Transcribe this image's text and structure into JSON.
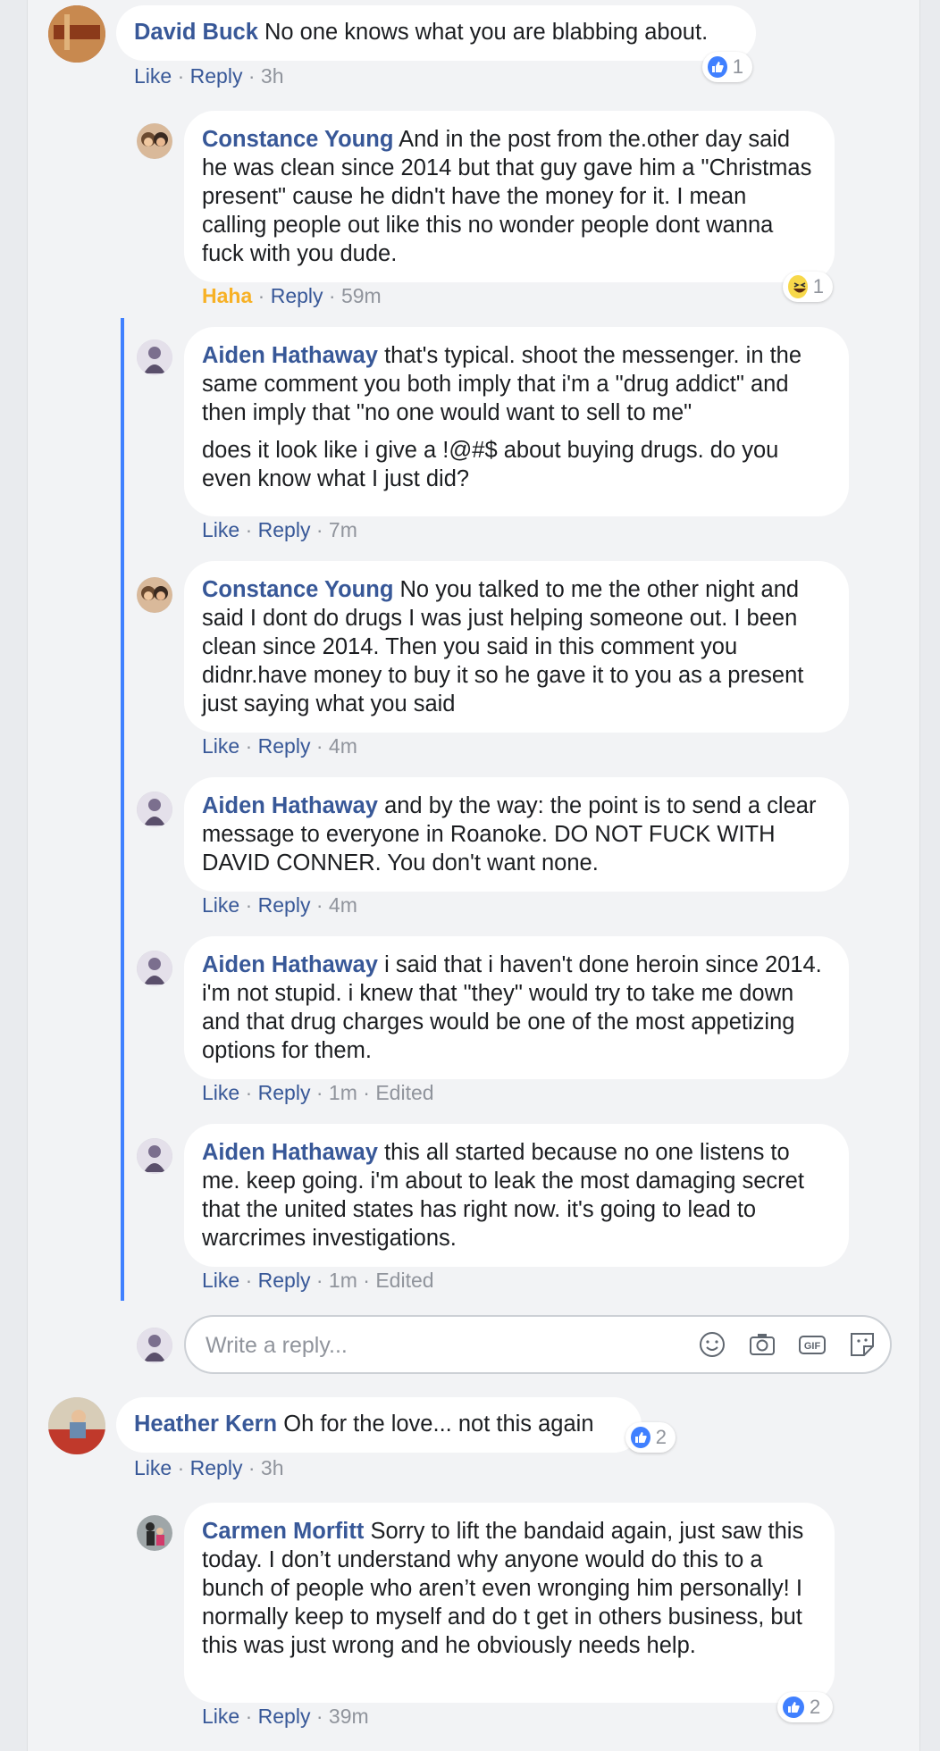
{
  "comments": [
    {
      "name": "David Buck",
      "text": "No one knows what you are blabbing about.",
      "actions": {
        "like": "Like",
        "reply": "Reply",
        "time": "3h"
      },
      "reaction": {
        "type": "like",
        "count": "1"
      }
    },
    {
      "name": "Constance Young",
      "text": "And in the post from the.other day said he was clean since 2014 but that guy gave him a \"Christmas present\" cause he didn't have the money for it. I mean calling people out like this no wonder people dont wanna fuck with you dude.",
      "actions": {
        "like": "Haha",
        "reply": "Reply",
        "time": "59m"
      },
      "reaction": {
        "type": "haha",
        "count": "1"
      }
    },
    {
      "name": "Aiden Hathaway",
      "text": "that's typical. shoot the messenger. in the same comment you both imply that i'm a \"drug addict\" and then imply that \"no one would want to sell to me\"",
      "text2": "does it look like i give a !@#$ about buying drugs. do you even know what I just did?",
      "actions": {
        "like": "Like",
        "reply": "Reply",
        "time": "7m"
      }
    },
    {
      "name": "Constance Young",
      "text": "No you talked to me the other night and said I dont do drugs I was just helping someone out. I been clean since 2014. Then you said in this comment you didnr.have money to buy it so he gave it to you as a present just saying what you said",
      "actions": {
        "like": "Like",
        "reply": "Reply",
        "time": "4m"
      }
    },
    {
      "name": "Aiden Hathaway",
      "text": "and by the way: the point is to send a clear message to everyone in Roanoke. DO NOT FUCK WITH DAVID CONNER. You don't want none.",
      "actions": {
        "like": "Like",
        "reply": "Reply",
        "time": "4m"
      }
    },
    {
      "name": "Aiden Hathaway",
      "text": "i said that i haven't done heroin since 2014. i'm not stupid. i knew that \"they\" would try to take me down and that drug charges would be one of the most appetizing options for them.",
      "actions": {
        "like": "Like",
        "reply": "Reply",
        "time": "1m",
        "edited": "Edited"
      }
    },
    {
      "name": "Aiden Hathaway",
      "text": "this all started because no one listens to me. keep going. i'm about to leak the most damaging secret that the united states has right now. it's going to lead to warcrimes investigations.",
      "actions": {
        "like": "Like",
        "reply": "Reply",
        "time": "1m",
        "edited": "Edited"
      }
    },
    {
      "name": "Heather Kern",
      "text": "Oh for the love... not this again",
      "actions": {
        "like": "Like",
        "reply": "Reply",
        "time": "3h"
      },
      "reaction": {
        "type": "like",
        "count": "2"
      }
    },
    {
      "name": "Carmen Morfitt",
      "text": "Sorry to lift the bandaid again, just saw this today. I don’t understand why anyone would do this to a bunch of people who aren’t even wronging him personally! I normally keep to myself and do t get in others business, but this was just wrong and he obviously needs help.",
      "actions": {
        "like": "Like",
        "reply": "Reply",
        "time": "39m"
      },
      "reaction": {
        "type": "like",
        "count": "2"
      }
    }
  ],
  "reply_box": {
    "placeholder": "Write a reply...",
    "tools": [
      "emoji-icon",
      "camera-icon",
      "gif-icon",
      "sticker-icon"
    ]
  },
  "colors": {
    "name": "#385898",
    "haha": "#f7b125",
    "thread": "#4080ff",
    "like": "#4080ff"
  }
}
